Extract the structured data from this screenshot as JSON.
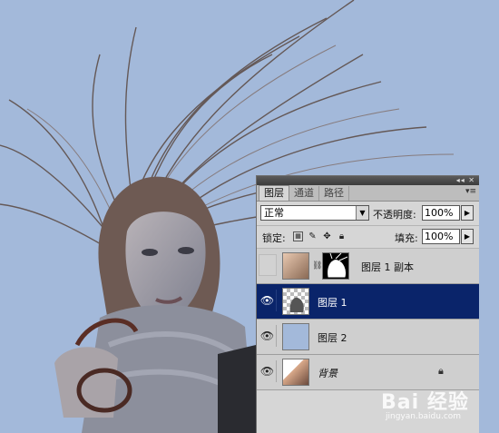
{
  "panel": {
    "tabs": [
      {
        "label": "图层"
      },
      {
        "label": "通道"
      },
      {
        "label": "路径"
      }
    ],
    "window_ctrl": "◂◂ ✕",
    "menu_icon": "▾≡",
    "blend_mode": "正常",
    "opacity_label": "不透明度:",
    "opacity_value": "100%",
    "lock_label": "锁定:",
    "fill_label": "填充:",
    "fill_value": "100%",
    "layers": [
      {
        "name": "图层 1 副本",
        "visible": false
      },
      {
        "name": "图层 1",
        "visible": true,
        "selected": true
      },
      {
        "name": "图层 2",
        "visible": true
      },
      {
        "name": "背景",
        "visible": true,
        "locked": true
      }
    ]
  },
  "watermark": {
    "text": "Bai 经验",
    "url": "jingyan.baidu.com"
  },
  "colors": {
    "canvas": "#a3b9da",
    "selected": "#0a246a"
  }
}
